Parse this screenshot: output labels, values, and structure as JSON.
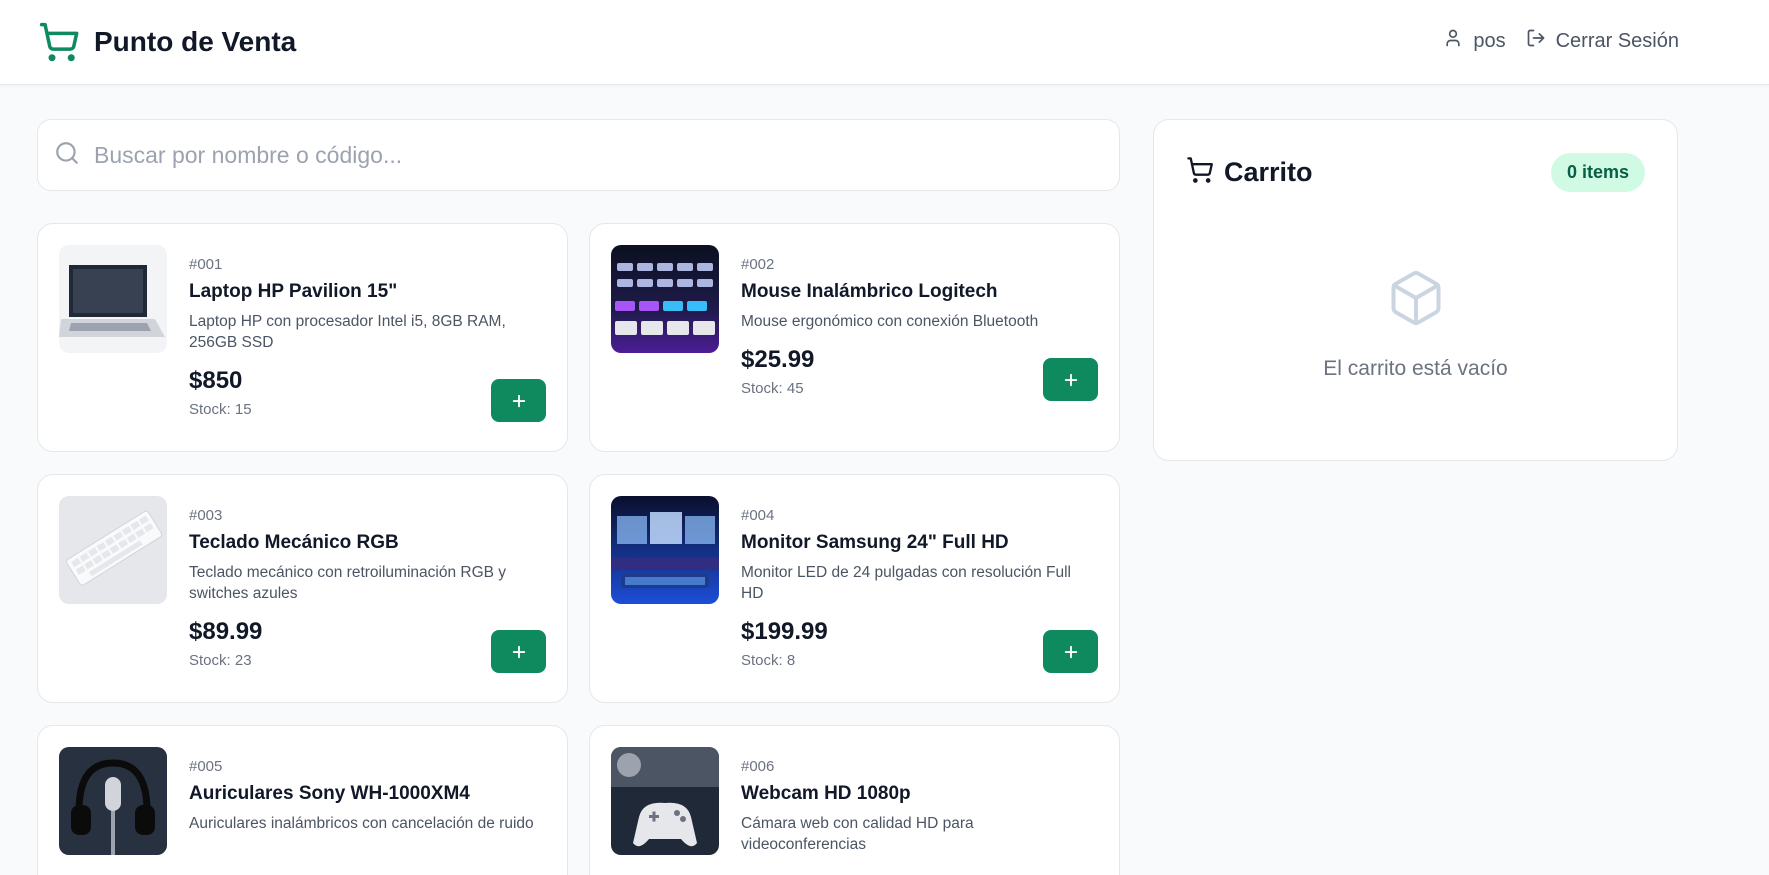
{
  "header": {
    "title": "Punto de Venta",
    "user": "pos",
    "logout": "Cerrar Sesión",
    "brand_color": "#0f8a5f"
  },
  "search": {
    "placeholder": "Buscar por nombre o código...",
    "value": ""
  },
  "products": [
    {
      "code": "#001",
      "name": "Laptop HP Pavilion 15\"",
      "desc": "Laptop HP con procesador Intel i5, 8GB RAM, 256GB SSD",
      "price": "$850",
      "stock": "Stock: 15",
      "add": "+"
    },
    {
      "code": "#002",
      "name": "Mouse Inalámbrico Logitech",
      "desc": "Mouse ergonómico con conexión Bluetooth",
      "price": "$25.99",
      "stock": "Stock: 45",
      "add": "+"
    },
    {
      "code": "#003",
      "name": "Teclado Mecánico RGB",
      "desc": "Teclado mecánico con retroiluminación RGB y switches azules",
      "price": "$89.99",
      "stock": "Stock: 23",
      "add": "+"
    },
    {
      "code": "#004",
      "name": "Monitor Samsung 24\" Full HD",
      "desc": "Monitor LED de 24 pulgadas con resolución Full HD",
      "price": "$199.99",
      "stock": "Stock: 8",
      "add": "+"
    },
    {
      "code": "#005",
      "name": "Auriculares Sony WH-1000XM4",
      "desc": "Auriculares inalámbricos con cancelación de ruido",
      "price": "",
      "stock": "",
      "add": ""
    },
    {
      "code": "#006",
      "name": "Webcam HD 1080p",
      "desc": "Cámara web con calidad HD para videoconferencias",
      "price": "",
      "stock": "",
      "add": ""
    }
  ],
  "cart": {
    "title": "Carrito",
    "count": "0 items",
    "empty": "El carrito está vacío"
  }
}
